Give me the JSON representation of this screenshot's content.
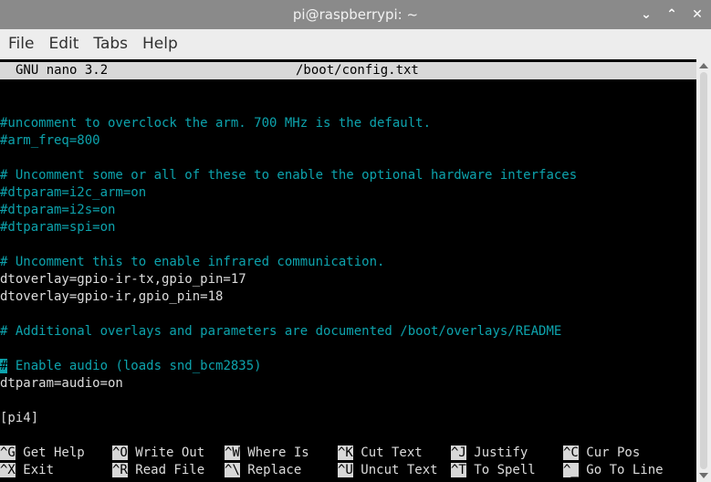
{
  "window": {
    "title": "pi@raspberrypi: ~",
    "controls": {
      "minimize": "⌄",
      "maximize": "⌃",
      "close": "✕"
    }
  },
  "menubar": {
    "items": [
      "File",
      "Edit",
      "Tabs",
      "Help"
    ]
  },
  "nano": {
    "version": "GNU nano 3.2",
    "filename": "/boot/config.txt"
  },
  "file_lines": [
    {
      "text": "#uncomment to overclock the arm. 700 MHz is the default.",
      "kind": "comment"
    },
    {
      "text": "#arm_freq=800",
      "kind": "comment"
    },
    {
      "text": "",
      "kind": "blank"
    },
    {
      "text": "# Uncomment some or all of these to enable the optional hardware interfaces",
      "kind": "comment"
    },
    {
      "text": "#dtparam=i2c_arm=on",
      "kind": "comment"
    },
    {
      "text": "#dtparam=i2s=on",
      "kind": "comment"
    },
    {
      "text": "#dtparam=spi=on",
      "kind": "comment"
    },
    {
      "text": "",
      "kind": "blank"
    },
    {
      "text": "# Uncomment this to enable infrared communication.",
      "kind": "comment"
    },
    {
      "text": "dtoverlay=gpio-ir-tx,gpio_pin=17",
      "kind": "text"
    },
    {
      "text": "dtoverlay=gpio-ir,gpio_pin=18",
      "kind": "text"
    },
    {
      "text": "",
      "kind": "blank"
    },
    {
      "text": "# Additional overlays and parameters are documented /boot/overlays/README",
      "kind": "comment"
    },
    {
      "text": "",
      "kind": "blank"
    },
    {
      "text": "# Enable audio (loads snd_bcm2835)",
      "kind": "comment",
      "cursor": true
    },
    {
      "text": "dtparam=audio=on",
      "kind": "text"
    },
    {
      "text": "",
      "kind": "blank"
    },
    {
      "text": "[pi4]",
      "kind": "text"
    }
  ],
  "shortcuts": [
    [
      {
        "key": "^G",
        "label": " Get Help"
      },
      {
        "key": "^X",
        "label": " Exit"
      }
    ],
    [
      {
        "key": "^O",
        "label": " Write Out"
      },
      {
        "key": "^R",
        "label": " Read File"
      }
    ],
    [
      {
        "key": "^W",
        "label": " Where Is"
      },
      {
        "key": "^\\",
        "label": " Replace"
      }
    ],
    [
      {
        "key": "^K",
        "label": " Cut Text"
      },
      {
        "key": "^U",
        "label": " Uncut Text"
      }
    ],
    [
      {
        "key": "^J",
        "label": " Justify"
      },
      {
        "key": "^T",
        "label": " To Spell"
      }
    ],
    [
      {
        "key": "^C",
        "label": " Cur Pos"
      },
      {
        "key": "^_",
        "label": " Go To Line"
      }
    ]
  ],
  "colors": {
    "comment": "#0da3ad",
    "text": "#dcdcdc",
    "titlebar": "#8a8a8a",
    "menubar": "#ededed"
  }
}
